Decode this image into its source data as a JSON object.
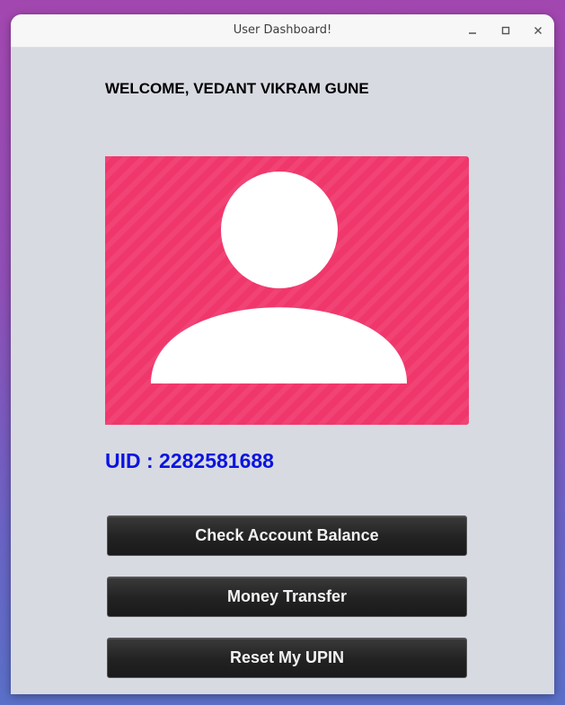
{
  "window": {
    "title": "User Dashboard!",
    "controls": {
      "minimize_icon": "minimize-icon",
      "maximize_icon": "maximize-icon",
      "close_icon": "close-icon"
    }
  },
  "welcome_text": "WELCOME, VEDANT VIKRAM GUNE",
  "profile": {
    "icon": "user-avatar-icon",
    "background_color": "#f0376c"
  },
  "uid_text": "UID : 2282581688",
  "buttons": {
    "check_balance": "Check Account Balance",
    "money_transfer": "Money Transfer",
    "reset_upin": "Reset My UPIN"
  },
  "colors": {
    "uid_text": "#0a14e0",
    "button_bg": "#222222",
    "window_bg": "#d8dae2"
  }
}
